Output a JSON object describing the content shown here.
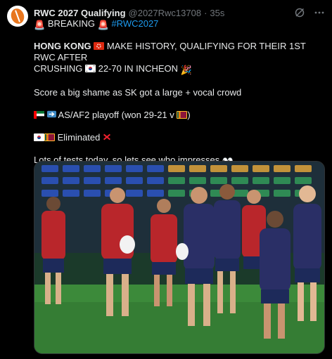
{
  "tweet": {
    "display_name": "RWC 2027 Qualifying",
    "handle": "@2027Rwc13708",
    "separator": "·",
    "time": "35s",
    "breaking": "BREAKING",
    "hashtag": "#RWC2027",
    "headline_bold": "HONG KONG",
    "headline_line1": "MAKE HISTORY, QUALIFYING FOR THEIR 1ST RWC AFTER",
    "headline_line2_a": "CRUSHING",
    "headline_line2_b": "22-70 IN INCHEON",
    "line_score": "Score a big shame as SK got a large + vocal crowd",
    "line_playoff": "AS/AF2 playoff (won 29-21 v",
    "line_playoff_end": ")",
    "line_eliminated": "Eliminated",
    "line_tests": "Lots of tests today, so lets see who impresses"
  },
  "icons": {
    "avatar": "rugby-ball-logo",
    "grok": "grok-icon",
    "more": "more-icon",
    "siren": "police-light-emoji",
    "arrow": "right-arrow-emoji",
    "cross": "cross-mark-emoji",
    "eyes": "eyes-emoji",
    "party": "party-popper-emoji"
  },
  "colors": {
    "background": "#000000",
    "text": "#e7e9ea",
    "muted": "#71767b",
    "link": "#1d9bf0"
  },
  "media": {
    "alt": "Hong Kong rugby players training on a pitch in front of stadium seats"
  }
}
